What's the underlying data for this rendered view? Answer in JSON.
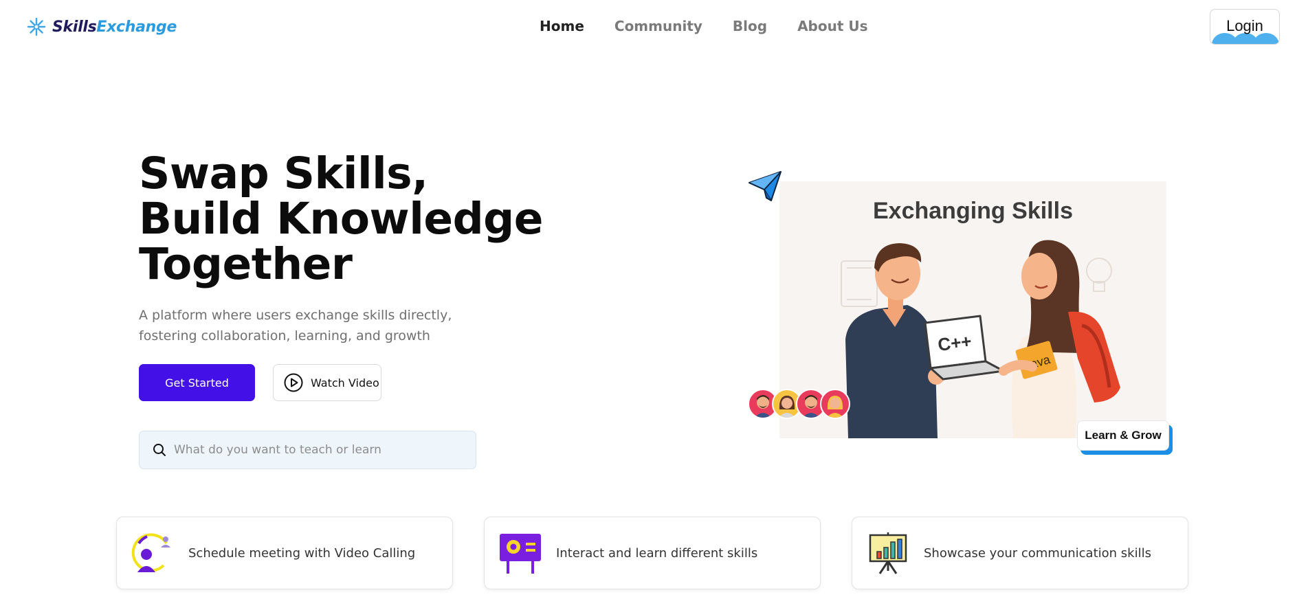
{
  "brand": {
    "name_part1": "Skills",
    "name_part2": "Exchange"
  },
  "nav": {
    "items": [
      {
        "label": "Home",
        "active": true
      },
      {
        "label": "Community",
        "active": false
      },
      {
        "label": "Blog",
        "active": false
      },
      {
        "label": "About Us",
        "active": false
      }
    ],
    "login_label": "Login"
  },
  "hero": {
    "title_lines": [
      "Swap Skills,",
      "Build Knowledge",
      "Together"
    ],
    "subtitle": "A platform where users exchange skills directly, fostering collaboration, learning, and growth",
    "primary_button": "Get Started",
    "video_button": "Watch Video",
    "search_placeholder": "What do you want to teach or learn"
  },
  "illustration": {
    "title": "Exchanging Skills",
    "laptop_text": "C++",
    "book_text": "Java",
    "badge": "Learn & Grow"
  },
  "features": [
    {
      "label": "Schedule meeting with Video Calling",
      "icon": "video-call-icon"
    },
    {
      "label": "Interact and learn different skills",
      "icon": "presentation-board-icon"
    },
    {
      "label": "Showcase your communication skills",
      "icon": "bar-chart-easel-icon"
    }
  ],
  "colors": {
    "primary": "#4410e8",
    "brand_dark": "#1f1b5c",
    "brand_light": "#2b9be0",
    "badge_shadow": "#1b8fe6",
    "search_bg": "#eef6fb"
  }
}
